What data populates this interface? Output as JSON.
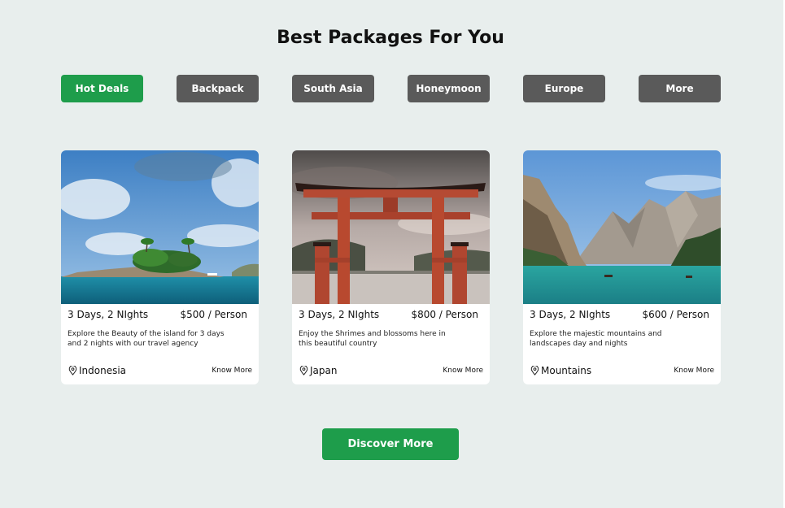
{
  "page": {
    "title": "Best Packages For You"
  },
  "tabs": [
    {
      "label": "Hot Deals",
      "active": true
    },
    {
      "label": "Backpack",
      "active": false
    },
    {
      "label": "South Asia",
      "active": false
    },
    {
      "label": "Honeymoon",
      "active": false
    },
    {
      "label": "Europe",
      "active": false
    },
    {
      "label": "More",
      "active": false
    }
  ],
  "packages": [
    {
      "duration": "3 Days, 2 NIghts",
      "price": "$500 / Person",
      "description": "Explore the Beauty of the island for 3 days and 2 nights with our travel agency",
      "location": "Indonesia",
      "cta": "Know More",
      "image": "tropical-island-photo"
    },
    {
      "duration": "3 Days, 2 NIghts",
      "price": "$800 / Person",
      "description": "Enjoy the Shrimes and blossoms here in this beautiful country",
      "location": "Japan",
      "cta": "Know More",
      "image": "torii-gate-photo"
    },
    {
      "duration": "3 Days, 2 NIghts",
      "price": "$600 / Person",
      "description": "Explore the majestic mountains and landscapes day and nights",
      "location": "Mountains",
      "cta": "Know More",
      "image": "mountain-lake-photo"
    }
  ],
  "discover": {
    "label": "Discover More"
  },
  "colors": {
    "accent": "#1e9d4b",
    "tab_inactive": "#5a5a5a",
    "background": "#e8eeed"
  }
}
